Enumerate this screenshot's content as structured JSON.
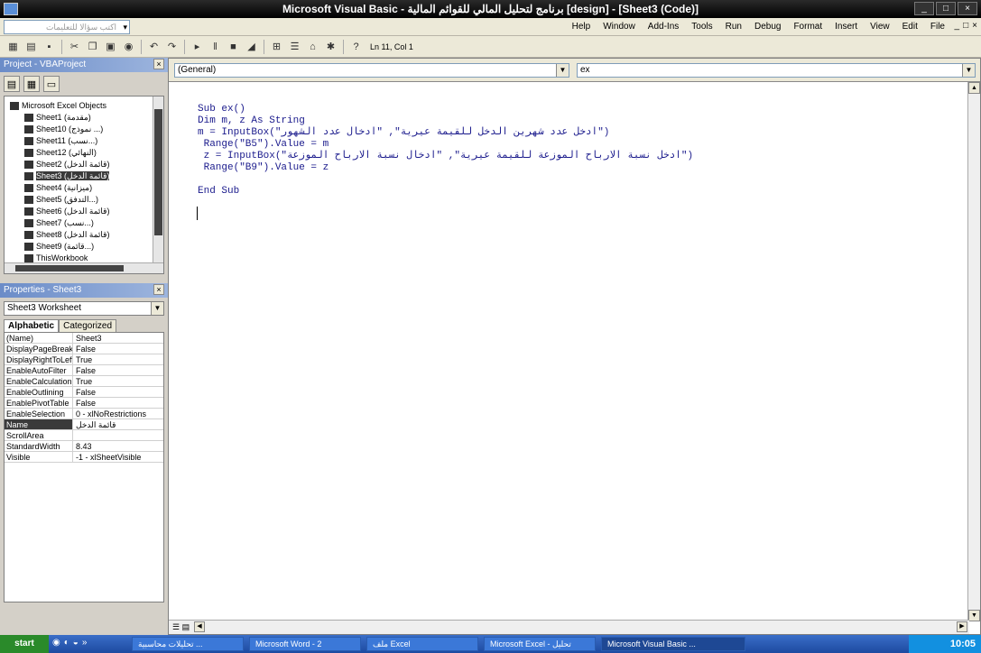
{
  "window": {
    "title": "Microsoft Visual Basic - برنامج لتحليل المالي للقوائم المالية [design] - [Sheet3 (Code)]",
    "controls": [
      "_",
      "□",
      "×"
    ]
  },
  "menubar": {
    "help_placeholder": "اكتب سؤالا للتعليمات",
    "help_arrow": "▾",
    "items": [
      "Help",
      "Window",
      "Add-Ins",
      "Tools",
      "Run",
      "Debug",
      "Format",
      "Insert",
      "View",
      "Edit",
      "File"
    ],
    "mdi_controls": [
      "_",
      "□",
      "×"
    ]
  },
  "toolbar": {
    "icons": [
      "excel-icon",
      "insert-icon",
      "save-icon",
      "cut-icon",
      "copy-icon",
      "paste-icon",
      "find-icon",
      "undo-icon",
      "redo-icon",
      "run-icon",
      "break-icon",
      "reset-icon",
      "design-mode-icon",
      "project-explorer-icon",
      "properties-icon",
      "object-browser-icon",
      "toolbox-icon",
      "help-icon"
    ],
    "position": "Ln 11, Col 1"
  },
  "project": {
    "title": "Project - VBAProject",
    "close": "×",
    "tree": [
      {
        "label": "Microsoft Excel Objects",
        "indent": 0,
        "selected": false
      },
      {
        "label": "Sheet1 (مقدمة)",
        "indent": 1,
        "selected": false
      },
      {
        "label": "Sheet10 (نموذج ...)",
        "indent": 1,
        "selected": false
      },
      {
        "label": "Sheet11 (نسب...)",
        "indent": 1,
        "selected": false
      },
      {
        "label": "Sheet12 (النهائي)",
        "indent": 1,
        "selected": false
      },
      {
        "label": "Sheet2 (قائمة الدخل)",
        "indent": 1,
        "selected": false
      },
      {
        "label": "Sheet3 (قائمة الدخل)",
        "indent": 1,
        "selected": true
      },
      {
        "label": "Sheet4 (ميزانية)",
        "indent": 1,
        "selected": false
      },
      {
        "label": "Sheet5 (التدفق...)",
        "indent": 1,
        "selected": false
      },
      {
        "label": "Sheet6 (قائمة الدخل)",
        "indent": 1,
        "selected": false
      },
      {
        "label": "Sheet7 (نسب...)",
        "indent": 1,
        "selected": false
      },
      {
        "label": "Sheet8 (قائمة الدخل)",
        "indent": 1,
        "selected": false
      },
      {
        "label": "Sheet9 (قائمة...)",
        "indent": 1,
        "selected": false
      },
      {
        "label": "ThisWorkbook",
        "indent": 1,
        "selected": false
      }
    ]
  },
  "properties": {
    "title": "Properties - Sheet3",
    "close": "×",
    "object": "Sheet3 Worksheet",
    "tabs": [
      "Alphabetic",
      "Categorized"
    ],
    "active_tab": "Alphabetic",
    "rows": [
      {
        "name": "(Name)",
        "value": "Sheet3",
        "selected": false
      },
      {
        "name": "DisplayPageBreaks",
        "value": "False",
        "selected": false
      },
      {
        "name": "DisplayRightToLeft",
        "value": "True",
        "selected": false
      },
      {
        "name": "EnableAutoFilter",
        "value": "False",
        "selected": false
      },
      {
        "name": "EnableCalculation",
        "value": "True",
        "selected": false
      },
      {
        "name": "EnableOutlining",
        "value": "False",
        "selected": false
      },
      {
        "name": "EnablePivotTable",
        "value": "False",
        "selected": false
      },
      {
        "name": "EnableSelection",
        "value": "0 - xlNoRestrictions",
        "selected": false
      },
      {
        "name": "Name",
        "value": "قائمة الدخل",
        "selected": true
      },
      {
        "name": "ScrollArea",
        "value": "",
        "selected": false
      },
      {
        "name": "StandardWidth",
        "value": "8.43",
        "selected": false
      },
      {
        "name": "Visible",
        "value": "-1 - xlSheetVisible",
        "selected": false
      }
    ]
  },
  "code": {
    "object_combo": "(General)",
    "proc_combo": "ex",
    "lines": [
      "Sub ex()",
      "Dim m, z As String",
      "m = InputBox(\"ادخل عدد شهرين الدخل للقيمة عيرية\", \"ادخال عدد الشهور\")",
      " Range(\"B5\").Value = m",
      " z = InputBox(\"ادخل نسبة الارباح الموزعة للقيمة عيرية\", \"ادخال نسبة الارباح الموزعة\")",
      " Range(\"B9\").Value = z",
      "",
      "End Sub"
    ]
  },
  "taskbar": {
    "start": "start",
    "tasks": [
      "تحليلات محاسبية ...",
      "Microsoft Word - 2",
      "ملف Excel",
      "Microsoft Excel - تحليل",
      "Microsoft Visual Basic ..."
    ],
    "clock": "10:05"
  }
}
